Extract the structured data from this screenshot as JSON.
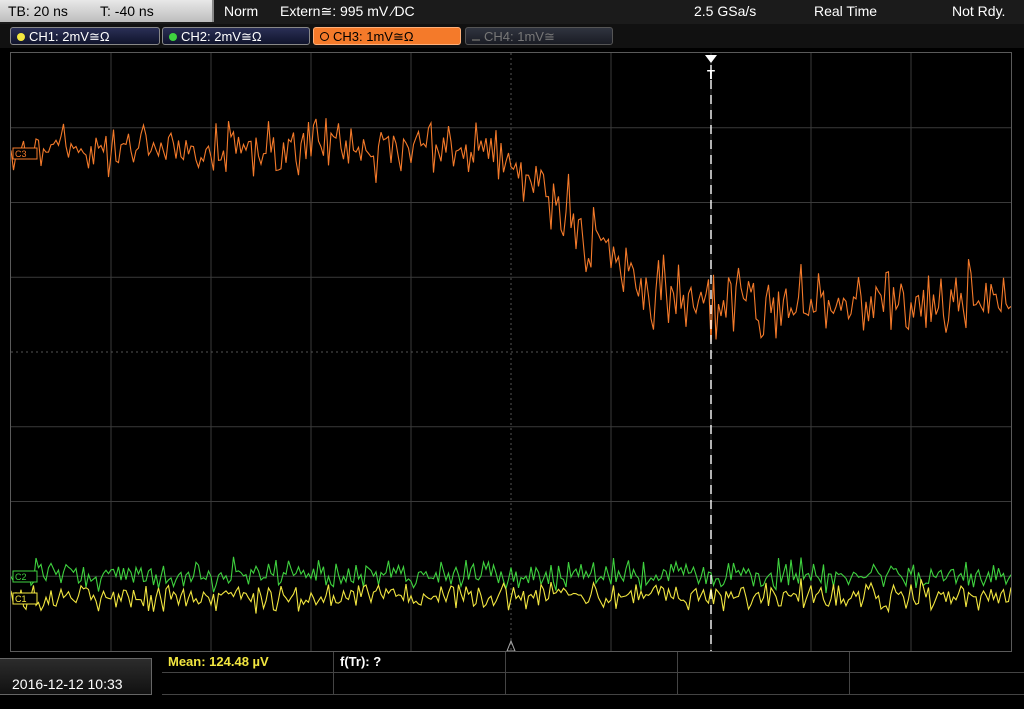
{
  "topbar": {
    "timebase": "TB: 20 ns",
    "trigger_pos": "T: -40 ns",
    "mode": "Norm",
    "trigger_source": "Extern≅: 995 mV ∕DC",
    "sample_rate": "2.5 GSa/s",
    "acq_mode": "Real Time",
    "status": "Not Rdy."
  },
  "channels": [
    {
      "label": "CH1: 2mV≅Ω",
      "color": "#f2e640"
    },
    {
      "label": "CH2: 2mV≅Ω",
      "color": "#3fd23f"
    },
    {
      "label": "CH3: 1mV≅Ω",
      "color": "#f47a2a"
    },
    {
      "label": "CH4: 1mV≅",
      "color": "#777777"
    }
  ],
  "markers": {
    "ch3": "C3",
    "ch2": "C2",
    "ch1": "C1",
    "trigger": "T"
  },
  "bottombar": {
    "datetime": "2016-12-12 10:33",
    "mean_label": "Mean: 124.48 µV",
    "ftr_label": "f(Tr): ?"
  },
  "colors": {
    "ch1": "#f2e640",
    "ch2": "#3fd23f",
    "ch3": "#f47a2a",
    "grid": "#3a3a3a"
  }
}
